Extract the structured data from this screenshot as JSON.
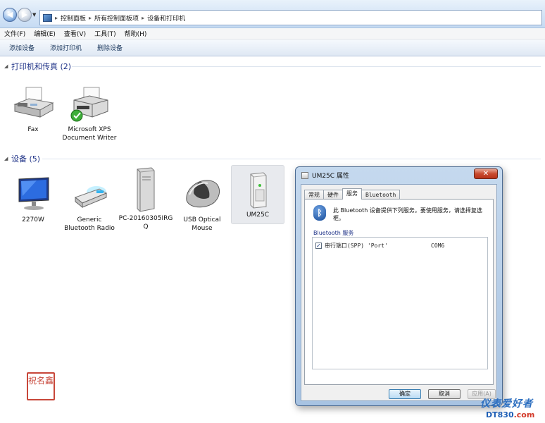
{
  "address_bar": {
    "breadcrumbs": [
      "控制面板",
      "所有控制面板项",
      "设备和打印机"
    ]
  },
  "menu": [
    "文件(F)",
    "编辑(E)",
    "查看(V)",
    "工具(T)",
    "帮助(H)"
  ],
  "toolbar": [
    "添加设备",
    "添加打印机",
    "删除设备"
  ],
  "printers_section": {
    "title": "打印机和传真 (2)",
    "items": [
      {
        "label": "Fax"
      },
      {
        "label": "Microsoft XPS Document Writer"
      }
    ]
  },
  "devices_section": {
    "title": "设备 (5)",
    "items": [
      {
        "label": "2270W"
      },
      {
        "label": "Generic Bluetooth Radio"
      },
      {
        "label": "PC-20160305IRGQ"
      },
      {
        "label": "USB Optical Mouse"
      },
      {
        "label": "UM25C"
      }
    ]
  },
  "dialog": {
    "title": "UM25C 属性",
    "close_label": "✕",
    "tabs": [
      "常规",
      "硬件",
      "服务",
      "Bluetooth"
    ],
    "active_tab": "服务",
    "description": "此 Bluetooth 设备提供下列服务。要使用服务，请选择复选框。",
    "group_label": "Bluetooth 服务",
    "services": [
      {
        "name": "串行端口(SPP) 'Port'",
        "port": "COM6",
        "checked": true
      }
    ],
    "buttons": {
      "ok": "确定",
      "cancel": "取消",
      "apply": "应用(A)"
    }
  },
  "seal_text": "祝名鑫",
  "watermark": {
    "line1": "仪表爱好者",
    "line2_a": "DT830",
    "line2_b": ".com"
  }
}
